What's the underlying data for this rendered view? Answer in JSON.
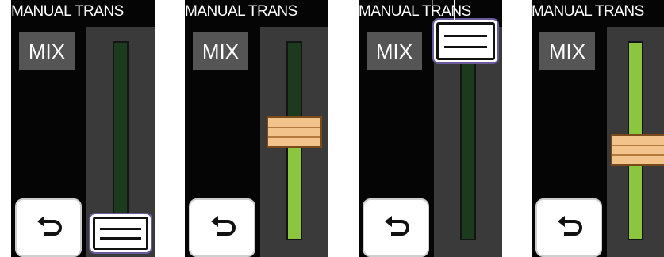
{
  "screens": [
    {
      "title": "MANUAL TRANS",
      "mix_label": "MIX",
      "fader_level": 0,
      "knob_style": "selected",
      "back_icon": "return-arrow-icon"
    },
    {
      "title": "MANUAL TRANS",
      "mix_label": "MIX",
      "fader_level": 0.53,
      "knob_style": "normal",
      "back_icon": "return-arrow-icon"
    },
    {
      "title": "MANUAL TRANS",
      "mix_label": "MIX",
      "fader_level": 1,
      "knob_style": "selected",
      "back_icon": "return-arrow-icon"
    },
    {
      "title": "MANUAL TRANS",
      "mix_label": "MIX",
      "fader_level": 0.42,
      "knob_style": "normal",
      "back_icon": "return-arrow-icon"
    }
  ],
  "colors": {
    "panel_bg": "#050505",
    "mix_bg": "#555555",
    "fader_bg": "#3a3a3a",
    "track_empty": "#1b3a1e",
    "track_fill": "#8cc63f",
    "knob_tan": "#f2c38a",
    "selection_ring": "#6a5a9e"
  }
}
